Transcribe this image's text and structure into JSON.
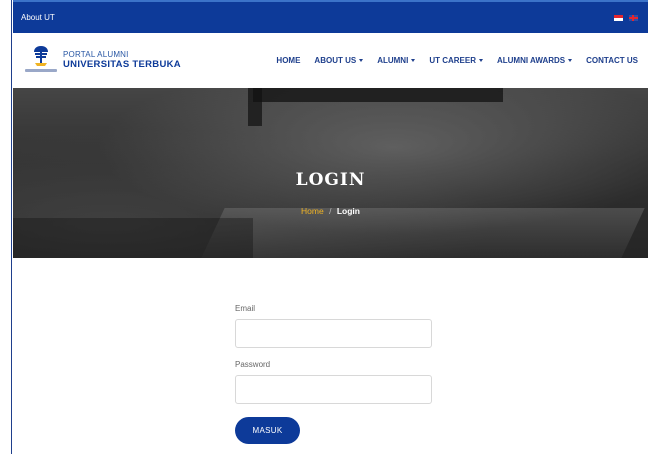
{
  "topbar": {
    "link": "About UT",
    "languages": [
      "id-flag-icon",
      "en-flag-icon"
    ]
  },
  "brand": {
    "small": "PORTAL ALUMNI",
    "big": "UNIVERSITAS TERBUKA"
  },
  "menu": [
    {
      "label": "HOME",
      "dropdown": false
    },
    {
      "label": "ABOUT US",
      "dropdown": true
    },
    {
      "label": "ALUMNI",
      "dropdown": true
    },
    {
      "label": "UT CAREER",
      "dropdown": true
    },
    {
      "label": "ALUMNI AWARDS",
      "dropdown": true
    },
    {
      "label": "CONTACT US",
      "dropdown": false
    }
  ],
  "hero": {
    "title": "LOGIN",
    "crumb_home": "Home",
    "crumb_sep": "/",
    "crumb_current": "Login"
  },
  "form": {
    "email_label": "Email",
    "email_value": "",
    "password_label": "Password",
    "password_value": "",
    "submit_label": "MASUK"
  },
  "colors": {
    "primary": "#0d3a99",
    "accent": "#f0b323"
  }
}
